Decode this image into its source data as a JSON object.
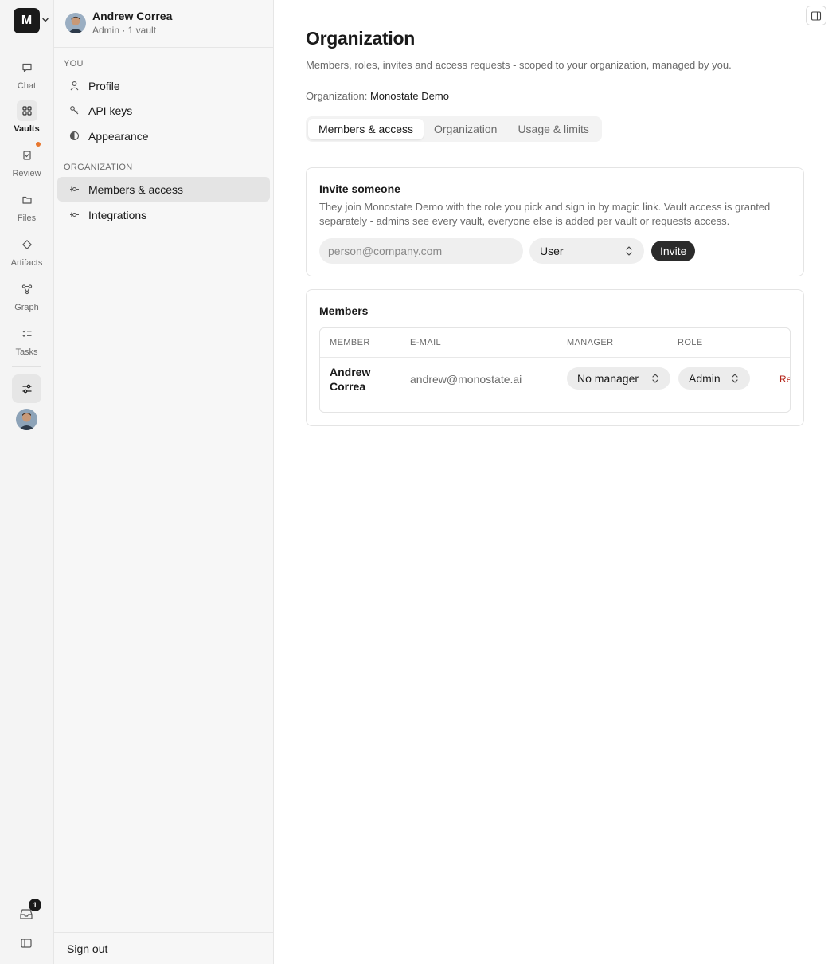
{
  "rail": {
    "org_initial": "M",
    "items": [
      {
        "label": "Chat",
        "icon": "chat-icon"
      },
      {
        "label": "Vaults",
        "icon": "vaults-icon"
      },
      {
        "label": "Review",
        "icon": "review-icon"
      },
      {
        "label": "Files",
        "icon": "folder-icon"
      },
      {
        "label": "Artifacts",
        "icon": "artifacts-icon"
      },
      {
        "label": "Graph",
        "icon": "graph-icon"
      },
      {
        "label": "Tasks",
        "icon": "tasks-icon"
      }
    ],
    "active_item": "Vaults",
    "inbox_badge": "1",
    "accent_dot_color": "#e8772e"
  },
  "sidebar": {
    "user_name": "Andrew Correa",
    "user_sub": "Admin · 1 vault",
    "you_label": "YOU",
    "you_items": [
      {
        "label": "Profile",
        "icon": "person-icon"
      },
      {
        "label": "API keys",
        "icon": "key-icon"
      },
      {
        "label": "Appearance",
        "icon": "contrast-icon"
      }
    ],
    "org_label": "ORGANIZATION",
    "org_items": [
      {
        "label": "Members & access",
        "icon": "members-icon"
      },
      {
        "label": "Integrations",
        "icon": "integrations-icon"
      }
    ],
    "active_item": "Members & access",
    "sign_out": "Sign out"
  },
  "main": {
    "title": "Organization",
    "subtitle": "Members, roles, invites and access requests - scoped to your organization, managed by you.",
    "org_prefix": "Organization:",
    "org_name": "Monostate Demo",
    "tabs": [
      {
        "label": "Members & access"
      },
      {
        "label": "Organization"
      },
      {
        "label": "Usage & limits"
      }
    ],
    "active_tab": "Members & access",
    "invite": {
      "title": "Invite someone",
      "description": "They join Monostate Demo with the role you pick and sign in by magic link. Vault access is granted separately - admins see every vault, everyone else is added per vault or requests access.",
      "email_placeholder": "person@company.com",
      "email_value": "",
      "role_value": "User",
      "button": "Invite"
    },
    "members": {
      "title": "Members",
      "columns": [
        "MEMBER",
        "E-MAIL",
        "MANAGER",
        "ROLE"
      ],
      "rows": [
        {
          "name": "Andrew Correa",
          "email": "andrew@monostate.ai",
          "manager": "No manager",
          "role": "Admin",
          "action": "Re"
        }
      ]
    }
  }
}
